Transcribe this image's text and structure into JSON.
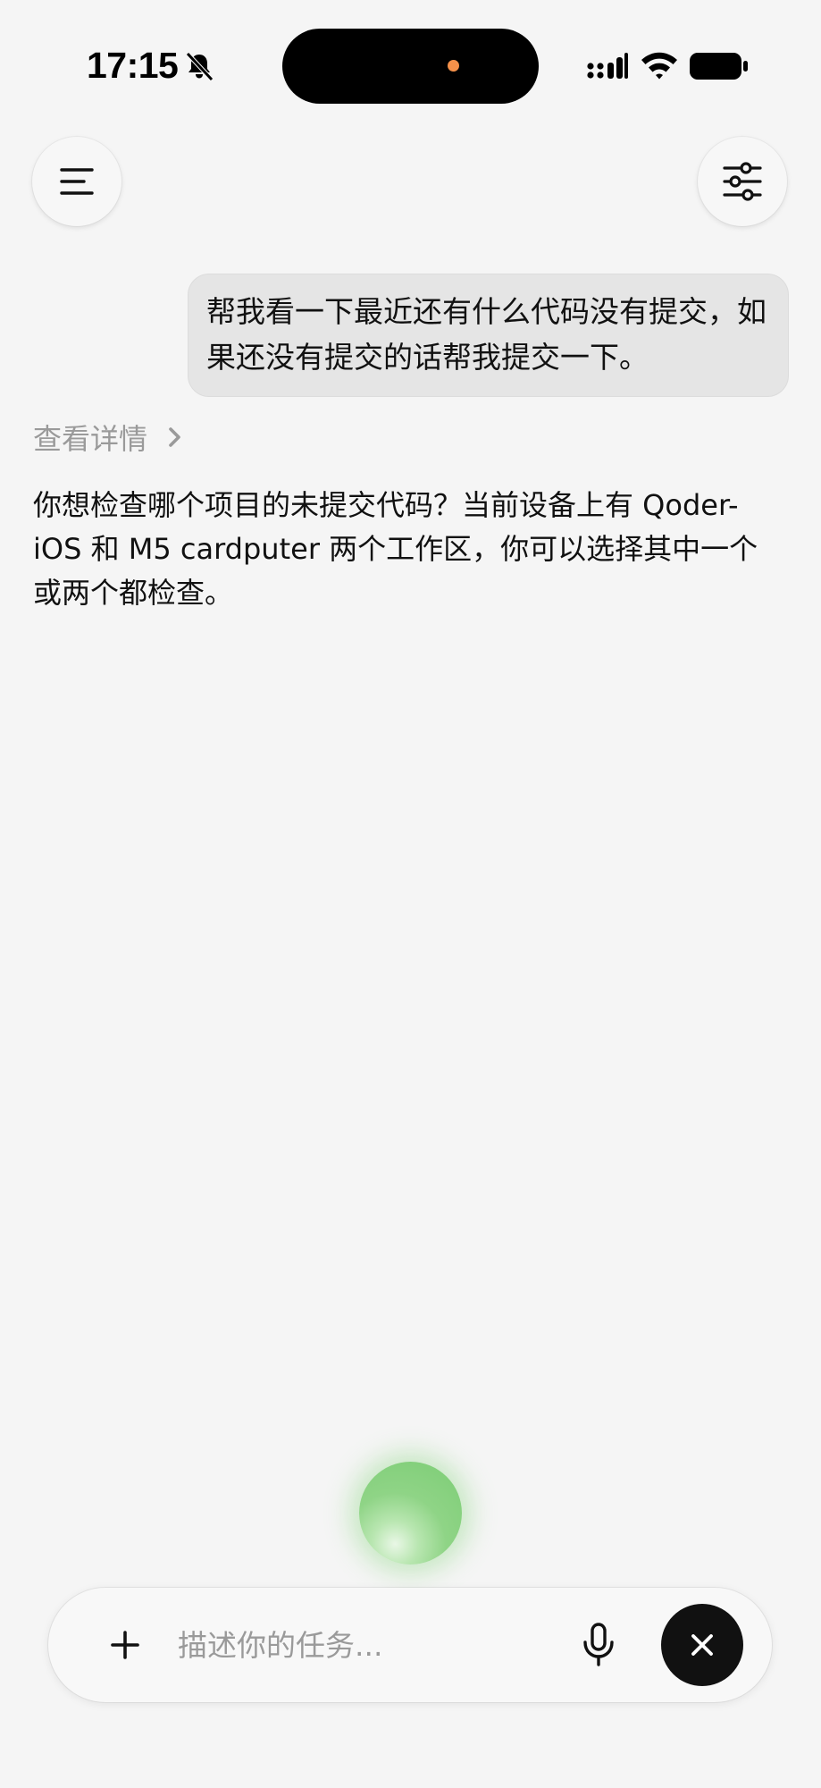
{
  "status_bar": {
    "time": "17:15",
    "icons": [
      "bell-muted-icon",
      "signal-icon",
      "wifi-icon",
      "battery-icon"
    ],
    "island_indicator_color": "#f5914a"
  },
  "header": {
    "menu_icon": "menu-icon",
    "settings_icon": "sliders-icon"
  },
  "conversation": {
    "user_message": "帮我看一下最近还有什么代码没有提交，如果还没有提交的话帮我提交一下。",
    "details_label": "查看详情",
    "assistant_message": "你想检查哪个项目的未提交代码？当前设备上有 Qoder-iOS 和 M5 cardputer 两个工作区，你可以选择其中一个或两个都检查。"
  },
  "voice_orb": {
    "color": "#7ccd75"
  },
  "input_bar": {
    "placeholder": "描述你的任务...",
    "value": "",
    "icons": [
      "plus-icon",
      "microphone-icon",
      "close-icon"
    ]
  },
  "colors": {
    "background": "#f5f5f5",
    "bubble": "#e5e5e5",
    "muted_text": "#9a9a9a",
    "primary_text": "#111111"
  }
}
